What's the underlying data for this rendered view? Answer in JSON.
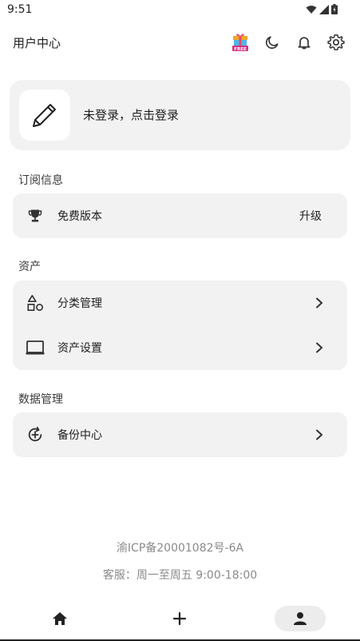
{
  "status_bar": {
    "time": "9:51"
  },
  "app_bar": {
    "title": "用户中心",
    "actions": [
      "gift-free-icon",
      "moon-icon",
      "bell-icon",
      "gear-icon"
    ]
  },
  "login": {
    "avatar_icon": "pencil-icon",
    "prompt": "未登录，点击登录"
  },
  "subscription": {
    "title": "订阅信息",
    "items": [
      {
        "icon": "trophy-icon",
        "label": "免费版本",
        "action": "升级"
      }
    ]
  },
  "assets": {
    "title": "资产",
    "items": [
      {
        "icon": "shapes-icon",
        "label": "分类管理"
      },
      {
        "icon": "laptop-icon",
        "label": "资产设置"
      }
    ]
  },
  "data_management": {
    "title": "数据管理",
    "items": [
      {
        "icon": "backup-icon",
        "label": "备份中心"
      }
    ]
  },
  "footer": {
    "icp": "渝ICP备20001082号-6A",
    "service": "客服：周一至周五 9:00-18:00"
  },
  "bottom_nav": {
    "items": [
      {
        "icon": "home-icon",
        "active": false
      },
      {
        "icon": "plus-icon",
        "active": false
      },
      {
        "icon": "person-icon",
        "active": true
      }
    ]
  },
  "colors": {
    "card_bg": "#f2f2f2",
    "text": "#1f1f1f",
    "muted": "#8a8a8a",
    "nav_active": "#ececec"
  }
}
